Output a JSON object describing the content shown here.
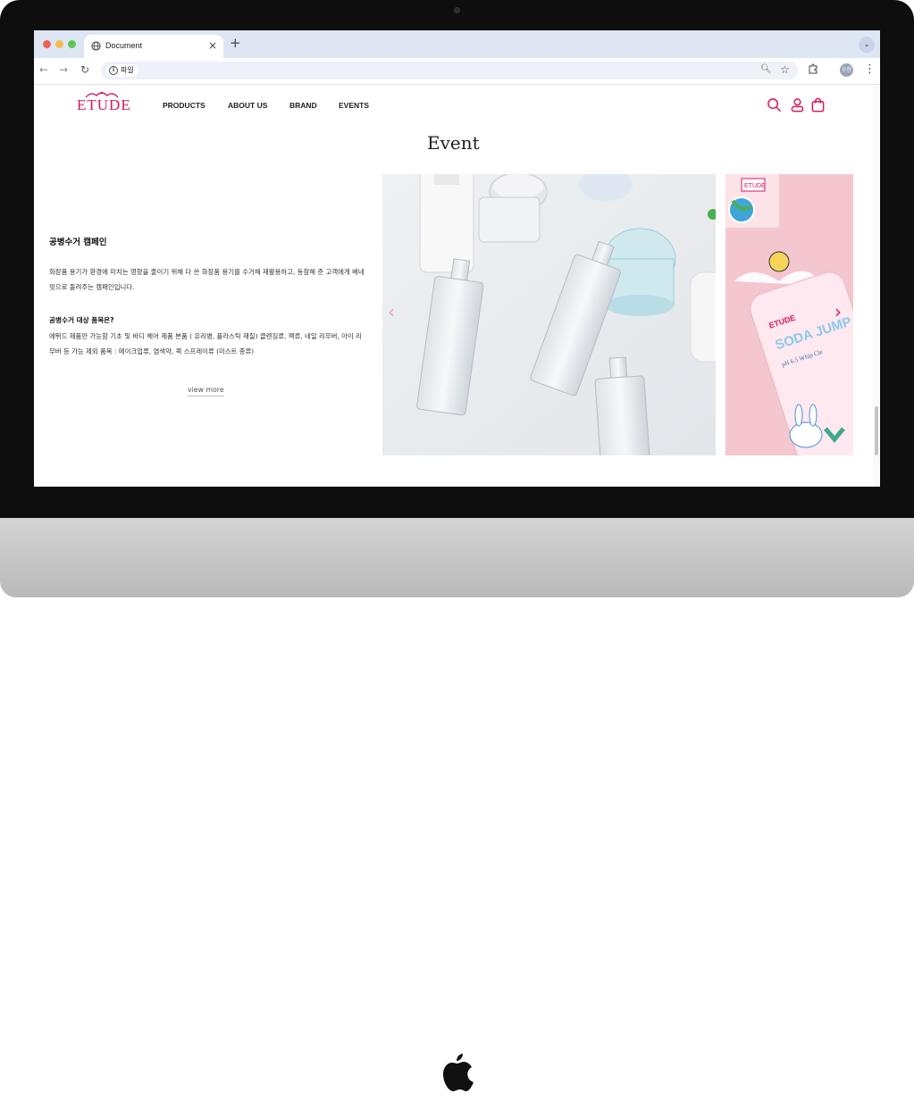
{
  "browser": {
    "tab_title": "Document",
    "close_tab": "×",
    "new_tab": "+",
    "tab_menu": "⌄",
    "nav_back": "←",
    "nav_forward": "→",
    "nav_reload": "↻",
    "address": "파일",
    "profile_initials": "수현",
    "menu_dots": "⋮"
  },
  "site": {
    "logo": "ETUDE",
    "nav": [
      "PRODUCTS",
      "ABOUT US",
      "BRAND",
      "EVENTS"
    ],
    "icons": [
      "search-icon",
      "user-icon",
      "cart-icon"
    ],
    "brand_color": "#d8175b"
  },
  "section": {
    "title": "Event"
  },
  "event": {
    "title": "공병수거 캠페인",
    "description": "화장품 용기가 환경에 미치는 영향을 줄이기 위해 다 쓴 화장품 용기를 수거해 재활용하고, 동참해 준 고객에게 베네핏으로 돌려주는 캠페인입니다.",
    "target_title": "공병수거 대상 품목은?",
    "target_description": "에뛰드 제품만 가능함 기초 및 바디 헤어 제품 본품 ( 유리병, 플라스틱 재질) 클렌징류, 팩류, 네일 리무버, 아이 리무버 등 가능 제외 품목 : 메이크업류, 염색약, 퀵 스프레이류 (미스트 종류)",
    "view_more": "view more"
  },
  "slider": {
    "prev": "‹",
    "next": "›",
    "slides": [
      {
        "name": "empty-bottles-photo"
      },
      {
        "name": "soda-jump-cleanser-poster",
        "brand": "ETUDE",
        "text_a": "SODA JUMP",
        "text_b": "pH 6.5 Whip Cle"
      }
    ]
  }
}
